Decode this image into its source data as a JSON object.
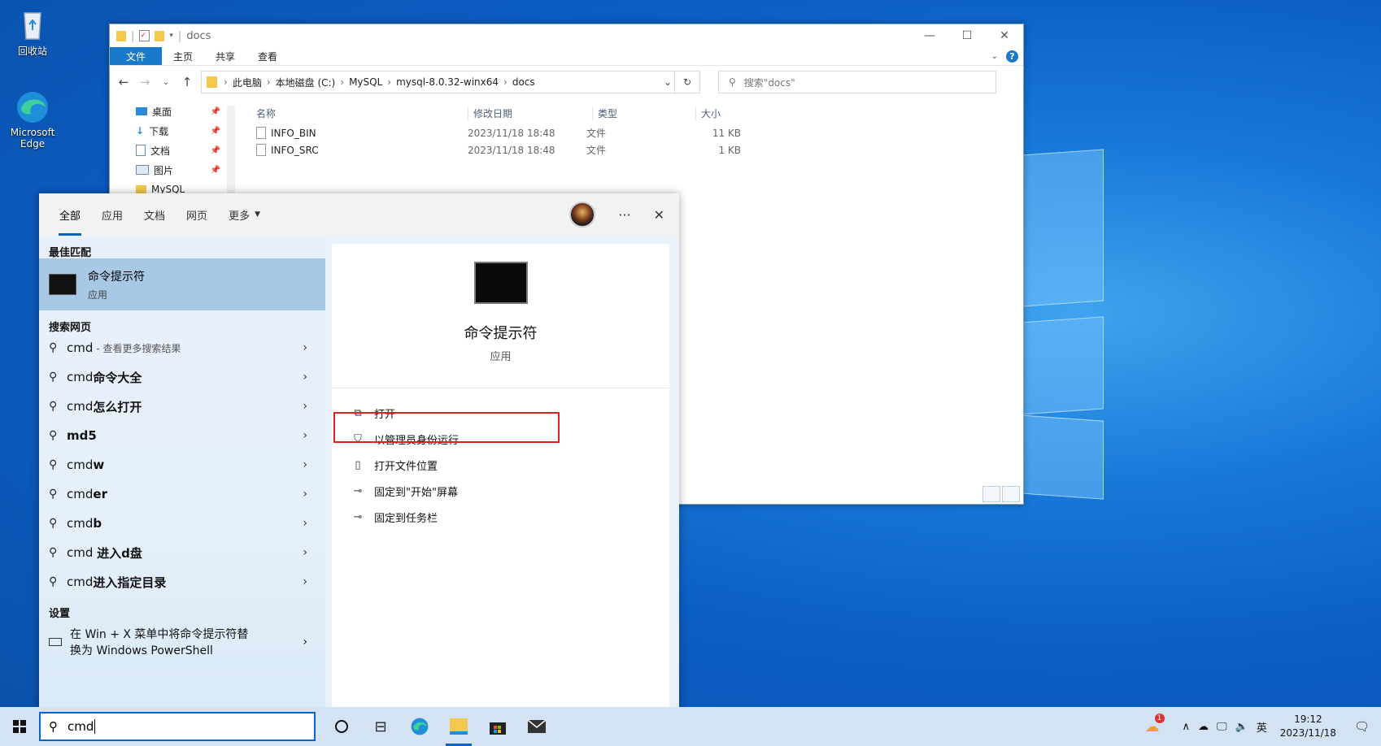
{
  "desktop": {
    "icons": [
      {
        "label": "回收站"
      },
      {
        "label": "Microsoft Edge"
      }
    ]
  },
  "explorer": {
    "title": "docs",
    "ribbon_tabs": [
      "文件",
      "主页",
      "共享",
      "查看"
    ],
    "breadcrumb": [
      "此电脑",
      "本地磁盘 (C:)",
      "MySQL",
      "mysql-8.0.32-winx64",
      "docs"
    ],
    "search_placeholder": "搜索\"docs\"",
    "nav_items": [
      "桌面",
      "下载",
      "文档",
      "图片",
      "MySQL"
    ],
    "columns": [
      "名称",
      "修改日期",
      "类型",
      "大小"
    ],
    "files": [
      {
        "name": "INFO_BIN",
        "date": "2023/11/18 18:48",
        "type": "文件",
        "size": "11 KB"
      },
      {
        "name": "INFO_SRC",
        "date": "2023/11/18 18:48",
        "type": "文件",
        "size": "1 KB"
      }
    ]
  },
  "search_panel": {
    "tabs": [
      "全部",
      "应用",
      "文档",
      "网页",
      "更多"
    ],
    "best_match_header": "最佳匹配",
    "best_match": {
      "title": "命令提示符",
      "subtitle": "应用"
    },
    "web_header": "搜索网页",
    "web_results": [
      {
        "prefix": "cmd",
        "bold": "",
        "sub": "- 查看更多搜索结果"
      },
      {
        "prefix": "cmd",
        "bold": "命令大全",
        "sub": ""
      },
      {
        "prefix": "cmd",
        "bold": "怎么打开",
        "sub": ""
      },
      {
        "prefix": "",
        "bold": "md5",
        "sub": ""
      },
      {
        "prefix": "cmd",
        "bold": "w",
        "sub": ""
      },
      {
        "prefix": "cmd",
        "bold": "er",
        "sub": ""
      },
      {
        "prefix": "cmd",
        "bold": "b",
        "sub": ""
      },
      {
        "prefix": "cmd ",
        "bold": "进入d盘",
        "sub": ""
      },
      {
        "prefix": "cmd",
        "bold": "进入指定目录",
        "sub": ""
      }
    ],
    "settings_header": "设置",
    "settings_result_line1": "在 Win + X 菜单中将命令提示符替",
    "settings_result_line2": "换为 Windows PowerShell",
    "app": {
      "title": "命令提示符",
      "subtitle": "应用"
    },
    "actions": [
      {
        "label": "打开",
        "icon": "open-icon"
      },
      {
        "label": "以管理员身份运行",
        "icon": "shield-icon"
      },
      {
        "label": "打开文件位置",
        "icon": "file-location-icon"
      },
      {
        "label": "固定到\"开始\"屏幕",
        "icon": "pin-icon"
      },
      {
        "label": "固定到任务栏",
        "icon": "pin-icon"
      }
    ]
  },
  "taskbar": {
    "search_value": "cmd",
    "ime": "英",
    "time": "19:12",
    "date": "2023/11/18",
    "weather_badge": "1"
  },
  "colors": {
    "accent": "#0a64c8",
    "highlight_box": "#e02020"
  }
}
